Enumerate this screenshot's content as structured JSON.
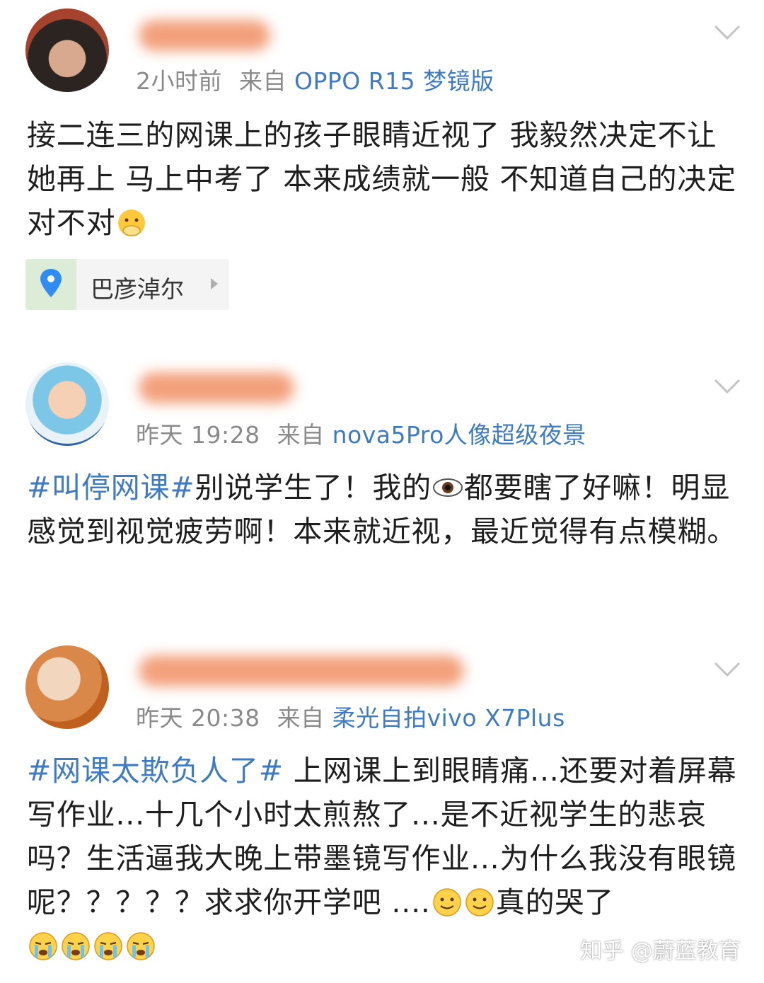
{
  "posts": [
    {
      "time": "2小时前",
      "source_prefix": "来自",
      "source": "OPPO R15 梦镜版",
      "text": "接二连三的网课上的孩子眼睛近视了 我毅然决定不让她再上 马上中考了 本来成绩就一般 不知道自己的决定对不对",
      "emoji": "covering-mouth-emoji",
      "location": "巴彦淖尔"
    },
    {
      "time": "昨天 19:28",
      "source_prefix": "来自",
      "source": "nova5Pro人像超级夜景",
      "hashtag": "#叫停网课#",
      "text_part1": "别说学生了！我的",
      "text_part2": "都要瞎了好嘛！明显感觉到视觉疲劳啊！本来就近视，最近觉得有点模糊。",
      "emoji": "eye-emoji"
    },
    {
      "time": "昨天 20:38",
      "source_prefix": "来自",
      "source": "柔光自拍vivo X7Plus",
      "hashtag": "#网课太欺负人了#",
      "text_part1": " 上网课上到眼睛痛...还要对着屏幕写作业...十几个小时太煎熬了...是不近视学生的悲哀吗？生活逼我大晚上带墨镜写作业...为什么我没有眼镜呢？？？？？求求你开学吧 ....",
      "text_part2": "真的哭了",
      "emojis": [
        "smile-emoji",
        "smile-emoji",
        "crying-emoji",
        "crying-emoji",
        "crying-emoji",
        "crying-emoji"
      ]
    }
  ],
  "watermark": "知乎 @蔚蓝教育",
  "colors": {
    "link": "#3f7bc2",
    "meta": "#8a8a8a",
    "text": "#1e1e1e"
  }
}
